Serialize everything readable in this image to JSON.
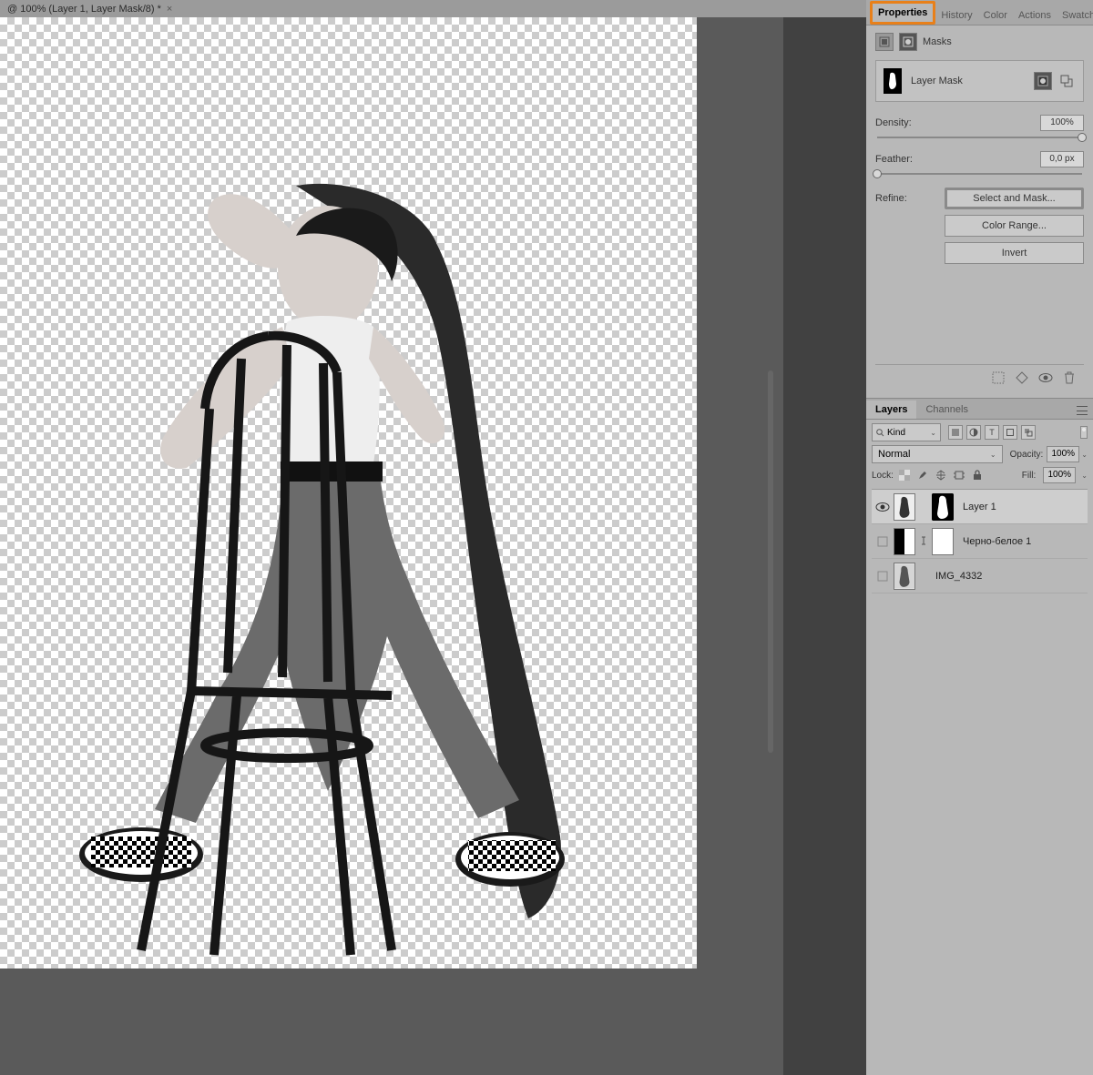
{
  "doc_tab": {
    "title": "@ 100% (Layer 1, Layer Mask/8) *"
  },
  "top_tabs": [
    "Properties",
    "History",
    "Color",
    "Actions",
    "Swatches"
  ],
  "top_active": "Properties",
  "properties": {
    "header_label": "Masks",
    "mask_label": "Layer Mask",
    "density": {
      "label": "Density:",
      "value": "100%",
      "pos": 100
    },
    "feather": {
      "label": "Feather:",
      "value": "0,0 px",
      "pos": 0
    },
    "refine_label": "Refine:",
    "refine_buttons": {
      "select_mask": "Select and Mask...",
      "color_range": "Color Range...",
      "invert": "Invert"
    }
  },
  "layers_tabs": [
    "Layers",
    "Channels"
  ],
  "layers_active": "Layers",
  "layers": {
    "kind_label": "Kind",
    "blend_mode": "Normal",
    "opacity_label": "Opacity:",
    "opacity_value": "100%",
    "lock_label": "Lock:",
    "fill_label": "Fill:",
    "fill_value": "100%",
    "rows": [
      {
        "name": "Layer 1",
        "visible": true,
        "selected": true,
        "has_mask": true
      },
      {
        "name": "Черно-белое 1",
        "visible": false,
        "adjustment": true,
        "has_mask": true
      },
      {
        "name": "IMG_4332",
        "visible": false
      }
    ]
  }
}
